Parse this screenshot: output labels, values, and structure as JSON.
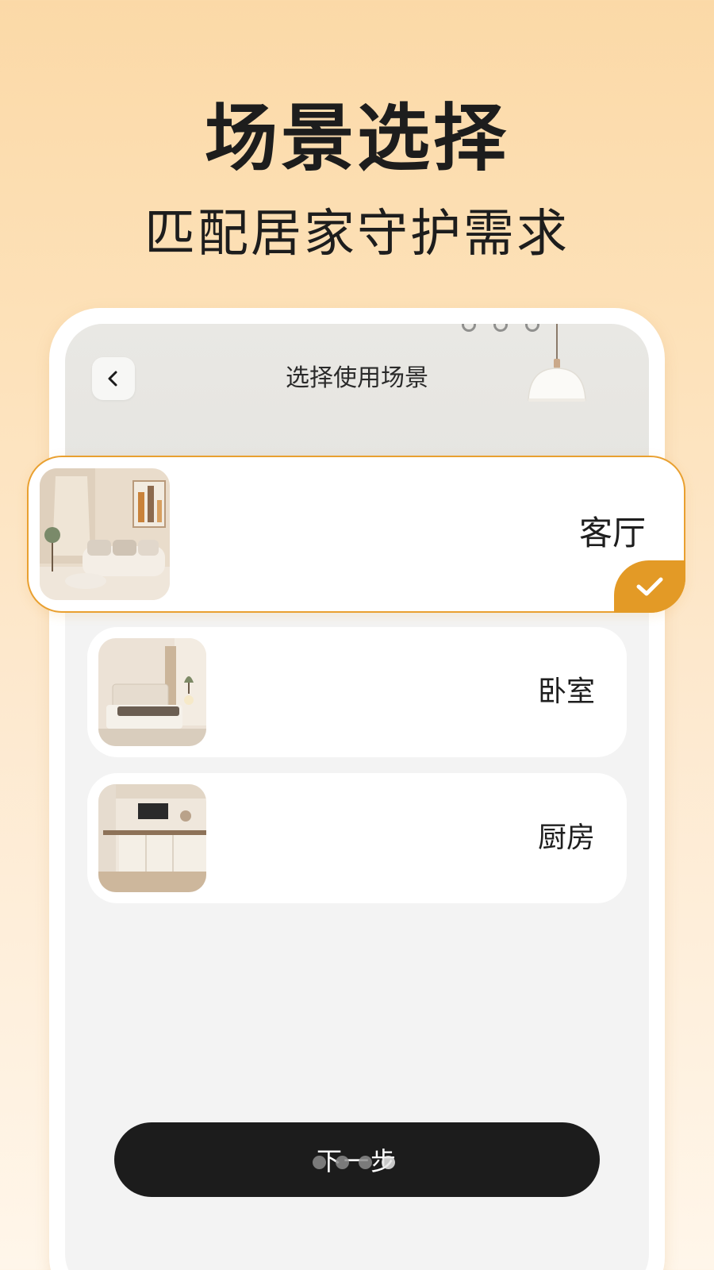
{
  "promo": {
    "headline": "场景选择",
    "subline": "匹配居家守护需求"
  },
  "screen": {
    "title": "选择使用场景",
    "back_icon": "chevron-left-icon"
  },
  "scenes": [
    {
      "label": "客厅",
      "selected": true,
      "image": "living-room-photo"
    },
    {
      "label": "卧室",
      "selected": false,
      "image": "bedroom-photo"
    },
    {
      "label": "厨房",
      "selected": false,
      "image": "kitchen-photo"
    }
  ],
  "next_button": {
    "label": "下一步"
  },
  "pagination": {
    "count": 4,
    "active_index": 3
  },
  "colors": {
    "accent": "#e39a26",
    "button_bg": "#1c1c1c",
    "background_top": "#fbd9a7",
    "background_bottom": "#fff6ea"
  }
}
